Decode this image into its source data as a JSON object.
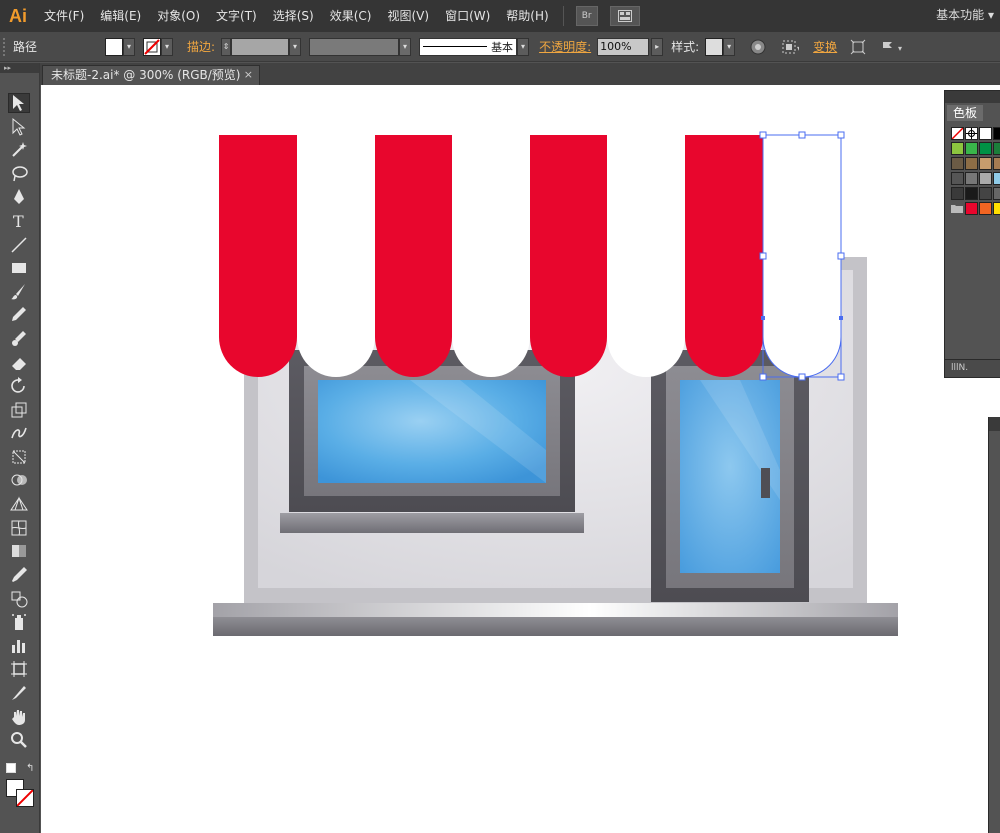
{
  "app": {
    "logo": "Ai",
    "workspace": "基本功能"
  },
  "menu": [
    "文件(F)",
    "编辑(E)",
    "对象(O)",
    "文字(T)",
    "选择(S)",
    "效果(C)",
    "视图(V)",
    "窗口(W)",
    "帮助(H)"
  ],
  "menubar_buttons": {
    "bridge": "Br",
    "arrange": "arrange-documents-icon"
  },
  "control": {
    "object_type": "路径",
    "stroke_label": "描边:",
    "stroke_profile": "基本",
    "opacity_label": "不透明度:",
    "opacity_value": "100%",
    "style_label": "样式:",
    "transform_label": "变换"
  },
  "document": {
    "tab_title": "未标题-2.ai* @ 300% (RGB/预览)",
    "close": "×"
  },
  "tools": [
    "selection-tool-icon",
    "direct-selection-tool-icon",
    "magic-wand-icon",
    "lasso-icon",
    "pen-tool-icon",
    "type-tool-icon",
    "line-tool-icon",
    "rectangle-tool-icon",
    "paintbrush-icon",
    "pencil-icon",
    "blob-brush-icon",
    "eraser-icon",
    "rotate-tool-icon",
    "scale-tool-icon",
    "warp-tool-icon",
    "free-transform-icon",
    "shape-builder-icon",
    "perspective-grid-icon",
    "mesh-tool-icon",
    "gradient-tool-icon",
    "eyedropper-icon",
    "blend-tool-icon",
    "symbol-sprayer-icon",
    "column-graph-icon",
    "artboard-tool-icon",
    "slice-tool-icon",
    "hand-tool-icon",
    "zoom-tool-icon"
  ],
  "panels": {
    "swatches": {
      "tab": "色板",
      "footer": "lllN."
    }
  },
  "colors": {
    "accent": "#f19b2c",
    "awning_red": "#e8062d",
    "glass_blue": "#4aa3e0",
    "selection": "#4a6cf0"
  }
}
